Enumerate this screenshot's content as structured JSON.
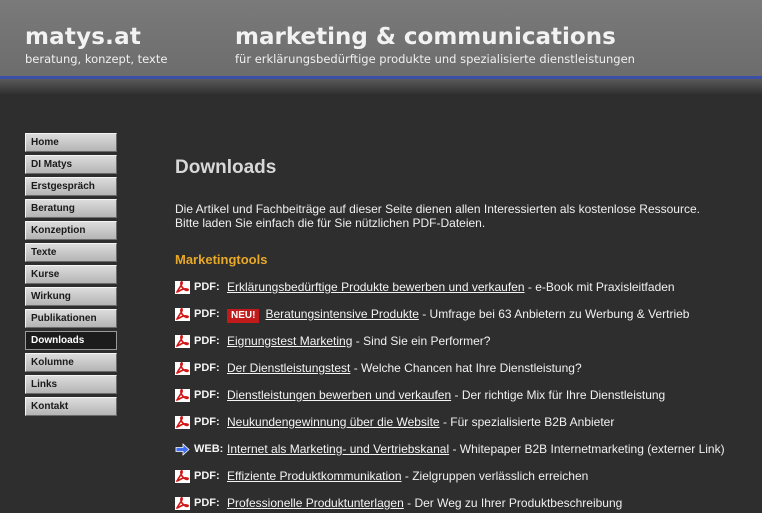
{
  "header": {
    "brand": "matys.at",
    "brand_subtitle": "beratung, konzept, texte",
    "tagline": "marketing & communications",
    "tagline_subtitle": "für erklärungsbedürftige produkte und spezialisierte dienstleistungen"
  },
  "nav": {
    "items": [
      {
        "label": "Home"
      },
      {
        "label": "DI Matys"
      },
      {
        "label": "Erstgespräch"
      },
      {
        "label": "Beratung"
      },
      {
        "label": "Konzeption"
      },
      {
        "label": "Texte"
      },
      {
        "label": "Kurse"
      },
      {
        "label": "Wirkung"
      },
      {
        "label": "Publikationen"
      },
      {
        "label": "Downloads",
        "active": true
      },
      {
        "label": "Kolumne"
      },
      {
        "label": "Links"
      },
      {
        "label": "Kontakt"
      }
    ]
  },
  "main": {
    "title": "Downloads",
    "intro_line1": "Die Artikel und Fachbeiträge auf dieser Seite dienen allen Interessierten als kostenlose Ressource.",
    "intro_line2": "Bitte laden Sie einfach die für Sie nützlichen PDF-Dateien.",
    "section_title": "Marketingtools"
  },
  "downloads": [
    {
      "type": "PDF:",
      "icon": "pdf-icon",
      "badge": "",
      "link": "Erklärungsbedürftige Produkte bewerben und verkaufen",
      "desc": " - e-Book mit Praxisleitfaden"
    },
    {
      "type": "PDF:",
      "icon": "pdf-icon",
      "badge": "NEU!",
      "link": "Beratungsintensive Produkte",
      "desc": " - Umfrage bei 63 Anbietern zu Werbung & Vertrieb"
    },
    {
      "type": "PDF:",
      "icon": "pdf-icon",
      "badge": "",
      "link": "Eignungstest Marketing",
      "desc": " - Sind Sie ein Performer?"
    },
    {
      "type": "PDF:",
      "icon": "pdf-icon",
      "badge": "",
      "link": "Der Dienstleistungstest",
      "desc": " - Welche Chancen hat Ihre Dienstleistung?"
    },
    {
      "type": "PDF:",
      "icon": "pdf-icon",
      "badge": "",
      "link": "Dienstleistungen bewerben und verkaufen",
      "desc": " - Der richtige Mix für Ihre Dienstleistung"
    },
    {
      "type": "PDF:",
      "icon": "pdf-icon",
      "badge": "",
      "link": "Neukundengewinnung über die Website",
      "desc": " - Für spezialisierte B2B Anbieter"
    },
    {
      "type": "WEB:",
      "icon": "web-arrow-icon",
      "badge": "",
      "link": "Internet als Marketing- und Vertriebskanal",
      "desc": " - Whitepaper B2B Internetmarketing (externer Link)"
    },
    {
      "type": "PDF:",
      "icon": "pdf-icon",
      "badge": "",
      "link": "Effiziente Produktkommunikation",
      "desc": " - Zielgruppen verlässlich erreichen"
    },
    {
      "type": "PDF:",
      "icon": "pdf-icon",
      "badge": "",
      "link": "Professionelle Produktunterlagen",
      "desc": " - Der Weg zu Ihrer Produktbeschreibung"
    }
  ],
  "colors": {
    "background": "#2e2e2e",
    "header": "#707070",
    "accent_rule": "#3b4fa6",
    "section_heading": "#e8a82a",
    "badge": "#c01a1a"
  }
}
